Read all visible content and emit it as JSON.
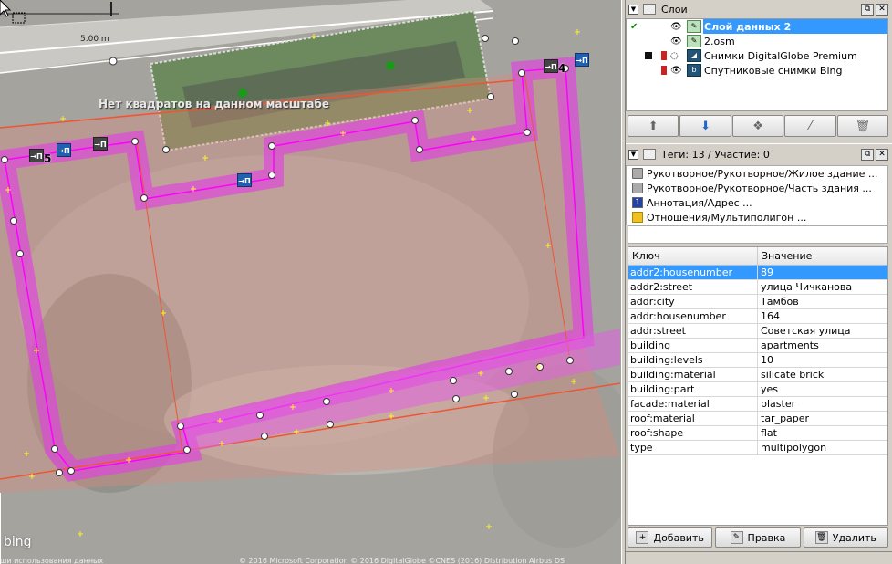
{
  "map": {
    "scale_label": "5.00 m",
    "no_squares_label": "Нет квадратов на данном масштабе",
    "bing_logo": "bing",
    "attribution": "© 2016 Microsoft Corporation © 2016 DigitalGlobe ©CNES (2016) Distribution Airbus DS",
    "attribution_left": "ши использования данных",
    "poi_labels": [
      "→П",
      "→П",
      "→П",
      "→П",
      "→П",
      "→П"
    ],
    "poi_numbers": [
      "5",
      "4"
    ]
  },
  "layers_panel": {
    "title": "Слои",
    "layers": [
      {
        "name": "Слой данных 2",
        "active": true,
        "checked": true
      },
      {
        "name": "2.osm",
        "active": false,
        "checked": false
      },
      {
        "name": "Снимки DigitalGlobe Premium",
        "active": false,
        "checked": false
      },
      {
        "name": "Спутниковые снимки Bing",
        "active": false,
        "checked": false
      }
    ],
    "toolbar_icons": [
      "move-up-icon",
      "move-down-icon",
      "merge-icon",
      "visibility-icon",
      "delete-icon"
    ]
  },
  "tags_panel": {
    "title": "Теги: 13 / Участие: 0",
    "relations": [
      {
        "text": "Рукотворное/Рукотворное/Жилое здание ...",
        "icon": "house"
      },
      {
        "text": "Рукотворное/Рукотворное/Часть здания ...",
        "icon": "house"
      },
      {
        "text": "Аннотация/Адрес ...",
        "icon": "addr"
      },
      {
        "text": "Отношения/Мультиполигон ...",
        "icon": "multi"
      }
    ],
    "columns": {
      "key": "Ключ",
      "value": "Значение"
    },
    "rows": [
      {
        "k": "addr2:housenumber",
        "v": "89"
      },
      {
        "k": "addr2:street",
        "v": "улица Чичканова"
      },
      {
        "k": "addr:city",
        "v": "Тамбов"
      },
      {
        "k": "addr:housenumber",
        "v": "164"
      },
      {
        "k": "addr:street",
        "v": "Советская улица"
      },
      {
        "k": "building",
        "v": "apartments"
      },
      {
        "k": "building:levels",
        "v": "10"
      },
      {
        "k": "building:material",
        "v": "silicate brick"
      },
      {
        "k": "building:part",
        "v": "yes"
      },
      {
        "k": "facade:material",
        "v": "plaster"
      },
      {
        "k": "roof:material",
        "v": "tar_paper"
      },
      {
        "k": "roof:shape",
        "v": "flat"
      },
      {
        "k": "type",
        "v": "multipolygon"
      }
    ],
    "add_label": "Добавить",
    "edit_label": "Правка",
    "delete_label": "Удалить"
  }
}
